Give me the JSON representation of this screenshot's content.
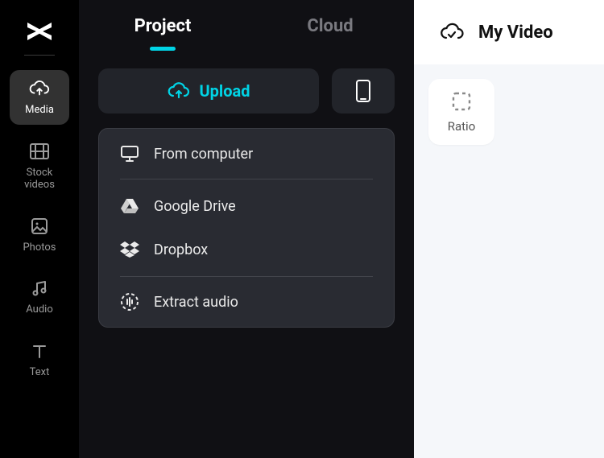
{
  "sidebar": {
    "items": [
      {
        "label": "Media"
      },
      {
        "label": "Stock\nvideos"
      },
      {
        "label": "Photos"
      },
      {
        "label": "Audio"
      },
      {
        "label": "Text"
      }
    ]
  },
  "tabs": {
    "project": "Project",
    "cloud": "Cloud"
  },
  "upload": {
    "label": "Upload"
  },
  "dropdown": {
    "from_computer": "From computer",
    "google_drive": "Google Drive",
    "dropbox": "Dropbox",
    "extract_audio": "Extract audio"
  },
  "right": {
    "title": "My Video",
    "ratio_label": "Ratio"
  }
}
